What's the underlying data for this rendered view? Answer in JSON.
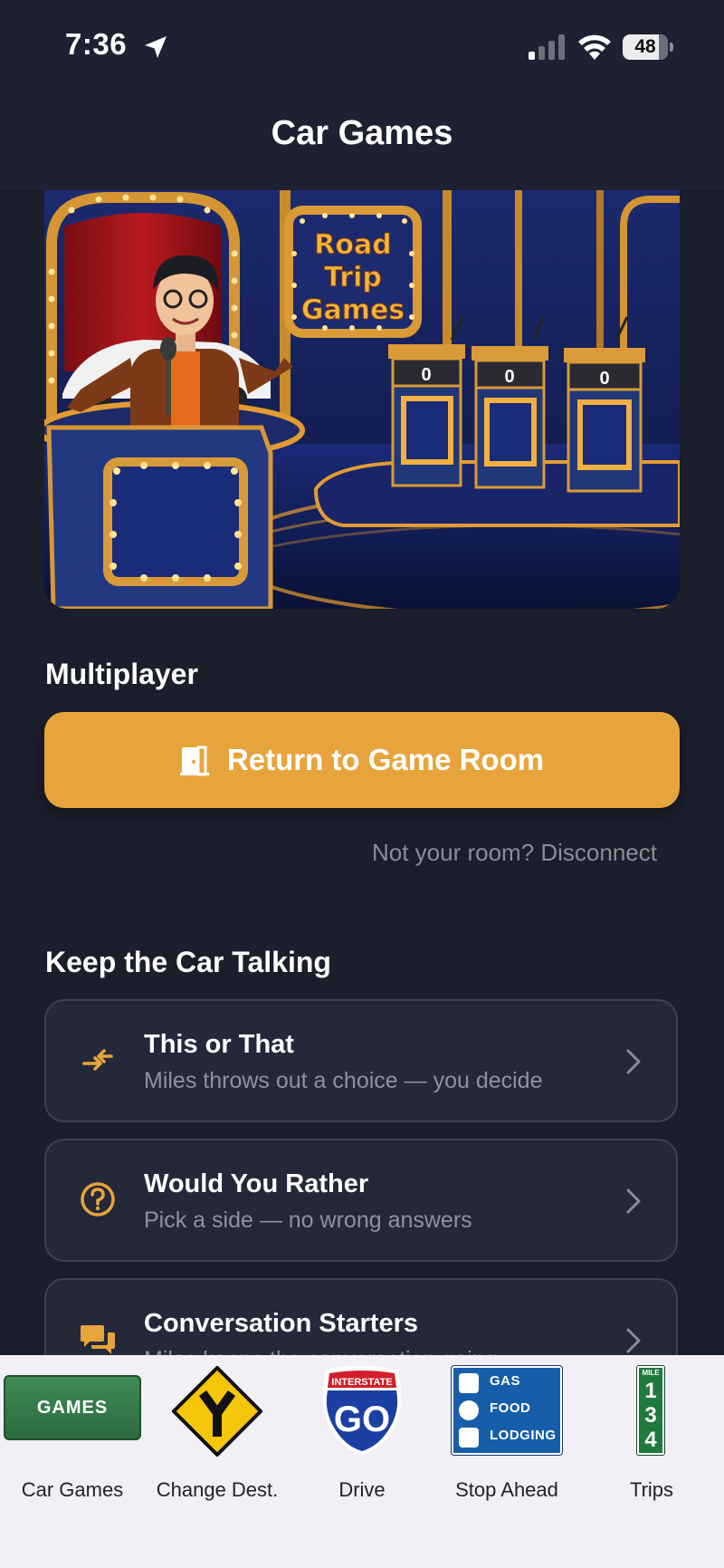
{
  "status_bar": {
    "time": "7:36",
    "battery": "48"
  },
  "nav": {
    "title": "Car Games"
  },
  "hero": {
    "sign_lines": [
      "Road",
      "Trip",
      "Games"
    ],
    "podium_scores": [
      "0",
      "0",
      "0"
    ]
  },
  "multiplayer": {
    "heading": "Multiplayer",
    "return_button": "Return to Game Room",
    "disconnect_link": "Not your room? Disconnect"
  },
  "talking": {
    "heading": "Keep the Car Talking",
    "items": [
      {
        "title": "This or That",
        "subtitle": "Miles throws out a choice — you decide",
        "icon": "swap-arrows-icon"
      },
      {
        "title": "Would You Rather",
        "subtitle": "Pick a side — no wrong answers",
        "icon": "question-circle-icon"
      },
      {
        "title": "Conversation Starters",
        "subtitle": "Miles keeps the conversation going",
        "icon": "chat-bubbles-icon"
      }
    ]
  },
  "tab_bar": {
    "tabs": [
      {
        "label": "Car Games",
        "badge": "GAMES",
        "icon": "games-sign-icon"
      },
      {
        "label": "Change Dest.",
        "icon": "y-junction-sign-icon"
      },
      {
        "label": "Drive",
        "badge_top": "INTERSTATE",
        "badge": "GO",
        "icon": "interstate-shield-icon"
      },
      {
        "label": "Stop Ahead",
        "rows": [
          "GAS",
          "FOOD",
          "LODGING"
        ],
        "icon": "services-sign-icon"
      },
      {
        "label": "Trips",
        "mile_word": "MILE",
        "digits": [
          "1",
          "3",
          "4"
        ],
        "icon": "mile-marker-icon"
      }
    ]
  },
  "colors": {
    "background": "#1b1e2b",
    "accent": "#e8a43c",
    "card": "#242839",
    "tab_bar": "#f2eff6"
  }
}
